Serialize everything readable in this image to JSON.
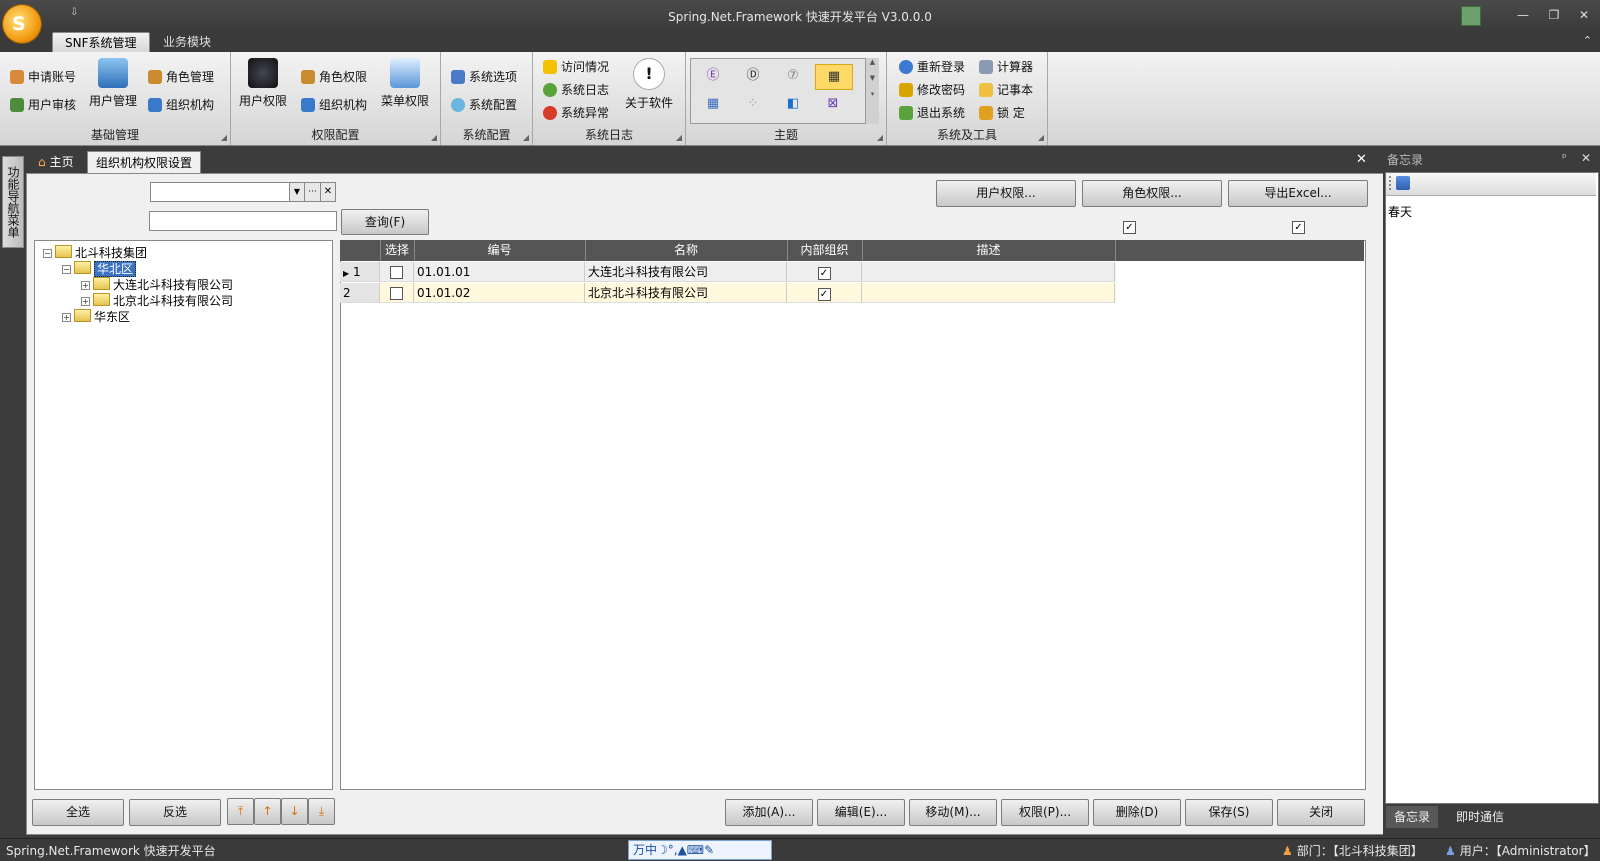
{
  "window": {
    "title": "Spring.Net.Framework 快速开发平台 V3.0.0.0",
    "qat_glyph": "⇩",
    "min_glyph": "—",
    "restore_glyph": "❐",
    "close_glyph": "✕",
    "collapse_glyph": "⌃",
    "logo_glyph": "S"
  },
  "ribbon": {
    "tabs": [
      {
        "label": "SNF系统管理"
      },
      {
        "label": "业务模块"
      }
    ],
    "groups": {
      "basic": {
        "caption": "基础管理",
        "apply_account": "申请账号",
        "user_review": "用户审核",
        "user_manage": "用户管理",
        "role_manage": "角色管理",
        "org": "组织机构"
      },
      "perm": {
        "caption": "权限配置",
        "user_perm": "用户权限",
        "role_perm": "角色权限",
        "org": "组织机构",
        "menu_perm": "菜单权限"
      },
      "sysconf": {
        "caption": "系统配置",
        "options": "系统选项",
        "config": "系统配置"
      },
      "syslog": {
        "caption": "系统日志",
        "visits": "访问情况",
        "log": "系统日志",
        "errors": "系统异常",
        "about": "关于软件"
      },
      "theme": {
        "caption": "主题",
        "cells": [
          "Ⓔ",
          "Ⓓ",
          "⑦",
          "▦",
          "▦",
          "⁘",
          "◧",
          "⊠"
        ]
      },
      "tools": {
        "caption": "系统及工具",
        "relogin": "重新登录",
        "change_pwd": "修改密码",
        "logout": "退出系统",
        "calculator": "计算器",
        "notepad": "记事本",
        "lock": "锁  定"
      }
    }
  },
  "left_nav": {
    "label": "功能导航菜单"
  },
  "doc_tabs": [
    {
      "label": "主页"
    },
    {
      "label": "组织机构权限设置"
    }
  ],
  "filters": {
    "combo_value": "",
    "combo_ellipsis": "···",
    "combo_clear": "✕",
    "search_value": "",
    "query_button": "查询(F)"
  },
  "actions_top": {
    "user_perm": "用户权限...",
    "role_perm": "角色权限...",
    "export": "导出Excel..."
  },
  "checks_top": [
    true,
    true
  ],
  "tree": {
    "nodes": [
      {
        "label": "北斗科技集团",
        "expander": "−"
      },
      {
        "label": "华北区",
        "expander": "−"
      },
      {
        "label": "大连北斗科技有限公司",
        "expander": "+"
      },
      {
        "label": "北京北斗科技有限公司",
        "expander": "+"
      },
      {
        "label": "华东区",
        "expander": "+"
      }
    ]
  },
  "grid": {
    "columns": [
      "选择",
      "编号",
      "名称",
      "内部组织",
      "描述"
    ],
    "rows": [
      {
        "index": "1",
        "selected": false,
        "code": "01.01.01",
        "name": "大连北斗科技有限公司",
        "internal": true,
        "desc": ""
      },
      {
        "index": "2",
        "selected": false,
        "code": "01.01.02",
        "name": "北京北斗科技有限公司",
        "internal": true,
        "desc": ""
      }
    ]
  },
  "bottom_left": {
    "select_all": "全选",
    "invert": "反选"
  },
  "bottom_right": {
    "add": "添加(A)...",
    "edit": "编辑(E)...",
    "move": "移动(M)...",
    "perm": "权限(P)...",
    "delete": "删除(D)",
    "save": "保存(S)",
    "close": "关闭"
  },
  "memo": {
    "title": "备忘录",
    "pin_glyph": "ᵖ",
    "close_glyph": "✕",
    "text": "春天",
    "tabs": [
      "备忘录",
      "即时通信"
    ]
  },
  "status": {
    "left": "Spring.Net.Framework 快速开发平台",
    "ime": "万中☽°,▲⌨✎",
    "dept": "部门：【北斗科技集团】",
    "user": "用户：【Administrator】"
  },
  "colors": {
    "accent_selected": "#3b72c4",
    "theme_selected": "#ffd965",
    "row_alt": "#fff8dc"
  }
}
